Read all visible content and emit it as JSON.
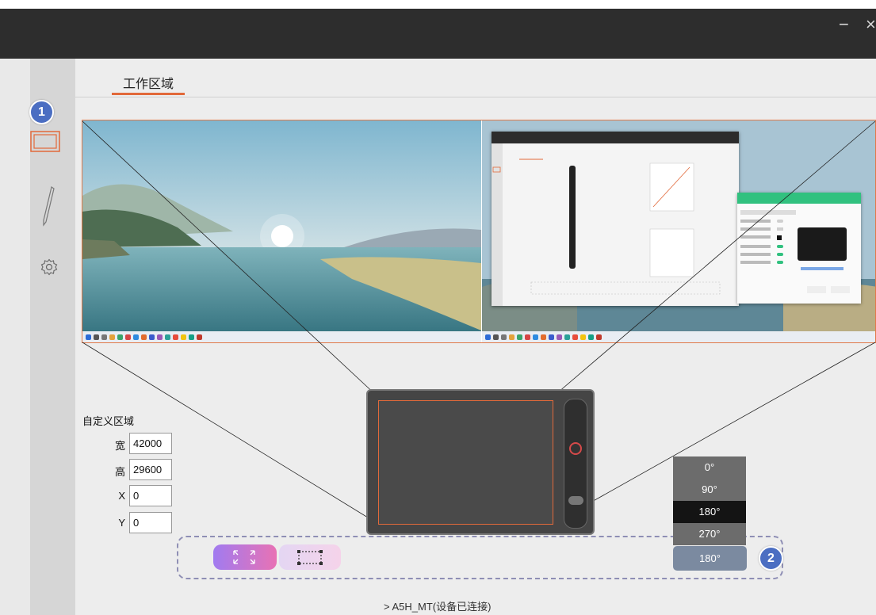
{
  "window": {
    "minimize_glyph": "−",
    "close_glyph": "×"
  },
  "tabs": [
    {
      "label": "工作区域",
      "active": true
    }
  ],
  "badges": {
    "one": "1",
    "two": "2"
  },
  "sidebar": {
    "items": [
      {
        "name": "workarea-icon",
        "active": true
      },
      {
        "name": "pen-icon",
        "active": false
      },
      {
        "name": "settings-icon",
        "active": false
      }
    ]
  },
  "custom_area": {
    "title": "自定义区域",
    "width_label": "宽",
    "width_value": "42000",
    "height_label": "高",
    "height_value": "29600",
    "x_label": "X",
    "x_value": "0",
    "y_label": "Y",
    "y_value": "0"
  },
  "rotation": {
    "options": [
      "0°",
      "90°",
      "180°",
      "270°"
    ],
    "selected_index": 2,
    "current": "180°"
  },
  "device_status": "A5H_MT(设备已连接)",
  "colors": {
    "accent": "#e2693a",
    "badge": "#4b6ec2",
    "titlebar": "#2d2d2d"
  }
}
